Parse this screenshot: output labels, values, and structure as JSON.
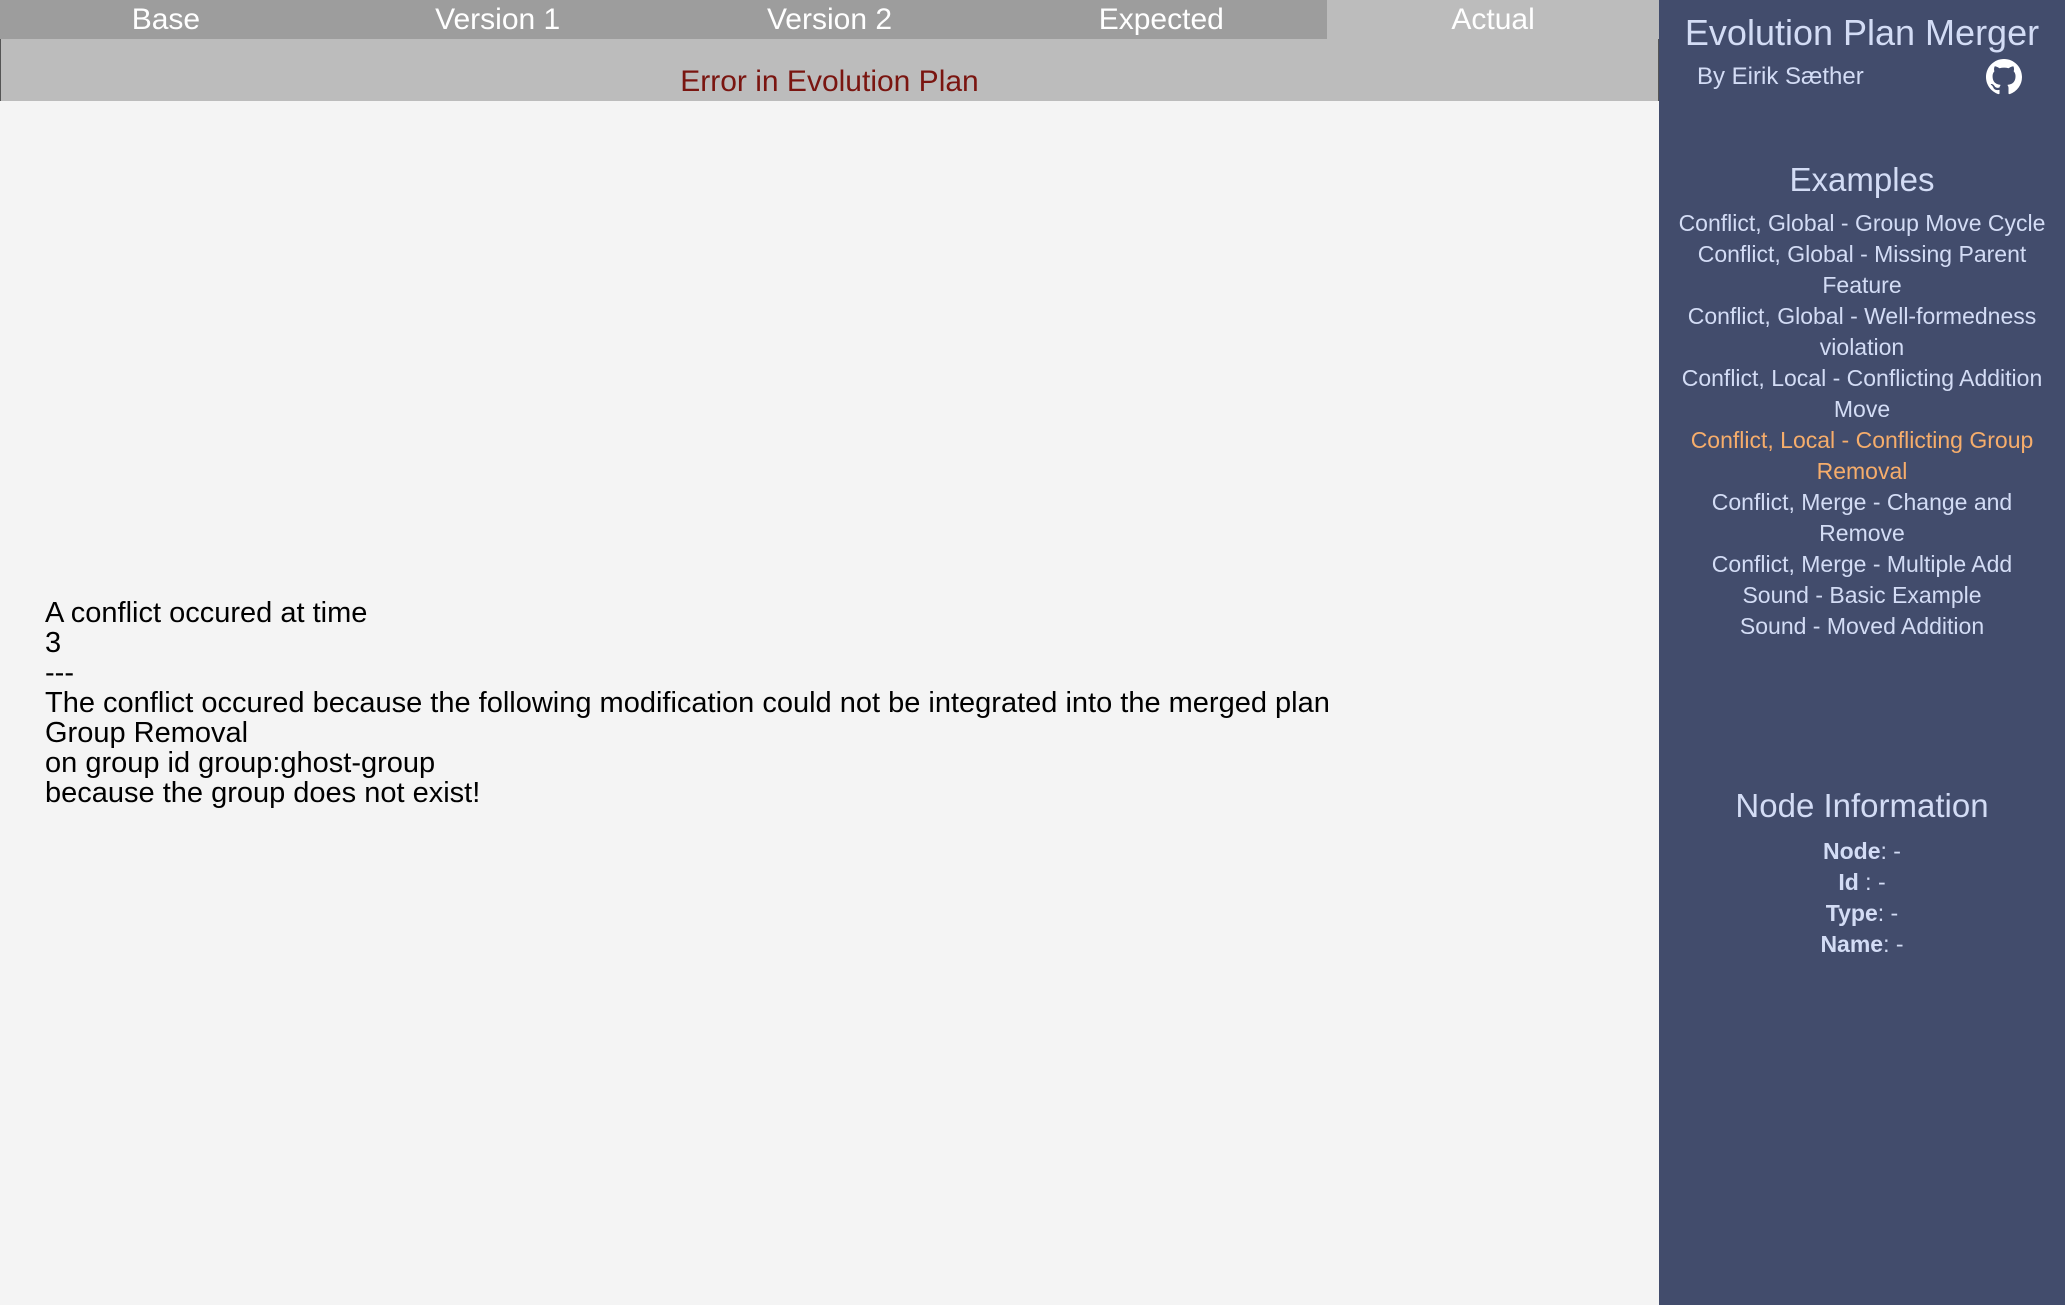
{
  "tabs": [
    {
      "label": "Base"
    },
    {
      "label": "Version 1"
    },
    {
      "label": "Version 2"
    },
    {
      "label": "Expected"
    },
    {
      "label": "Actual"
    }
  ],
  "active_tab": "Actual",
  "error_title": "Error in Evolution Plan",
  "message_lines": [
    "A conflict occured at time",
    "3",
    "---",
    "The conflict occured because the following modification could not be integrated into the merged plan",
    "Group Removal",
    "on group id group:ghost-group",
    "because the group does not exist!"
  ],
  "sidebar": {
    "title": "Evolution Plan Merger",
    "author": "By Eirik Sæther",
    "github_icon": "github-icon",
    "examples_title": "Examples",
    "examples": [
      "Conflict, Global - Group Move Cycle",
      "Conflict, Global - Missing Parent Feature",
      "Conflict, Global - Well-formedness violation",
      "Conflict, Local - Conflicting Addition Move",
      "Conflict, Local - Conflicting Group Removal",
      "Conflict, Merge - Change and Remove",
      "Conflict, Merge - Multiple Add",
      "Sound - Basic Example",
      "Sound - Moved Addition"
    ],
    "selected_example": "Conflict, Local - Conflicting Group Removal",
    "node_info_title": "Node Information",
    "node_info": {
      "node_label": "Node",
      "node_value": ": -",
      "id_label": "Id",
      "id_value": " : -",
      "type_label": "Type",
      "type_value": ": -",
      "name_label": "Name",
      "name_value": ": -"
    }
  },
  "colors": {
    "sidebar_bg": "#424c6c",
    "selected_example": "#f6ad6b",
    "error_text": "#7a1510",
    "tab_bg": "#9d9d9d",
    "active_tab_bg": "#bcbcbc"
  }
}
